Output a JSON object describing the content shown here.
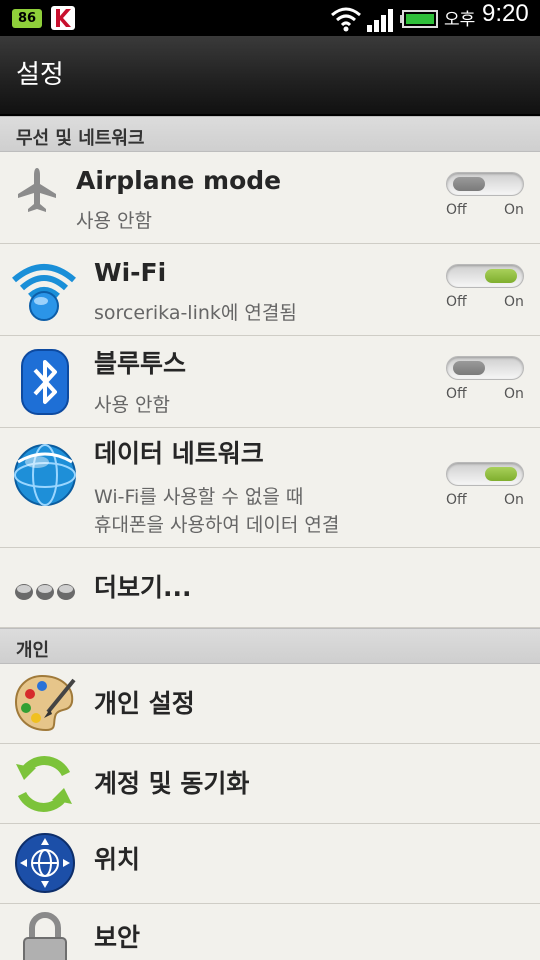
{
  "status_bar": {
    "battery_badge": "86",
    "ampm": "오후",
    "time": "9:20"
  },
  "title": "설정",
  "sections": {
    "wireless": "무선 및 네트워크",
    "personal": "개인"
  },
  "rows": {
    "airplane": {
      "label": "Airplane mode",
      "sub": "사용 안함",
      "toggle_off": "Off",
      "toggle_on": "On",
      "state": "off"
    },
    "wifi": {
      "label": "Wi-Fi",
      "sub": "sorcerika-link에 연결됨",
      "toggle_off": "Off",
      "toggle_on": "On",
      "state": "on"
    },
    "bluetooth": {
      "label": "블루투스",
      "sub": "사용 안함",
      "toggle_off": "Off",
      "toggle_on": "On",
      "state": "off"
    },
    "data": {
      "label": "데이터 네트워크",
      "sub1": "Wi-Fi를 사용할 수 없을 때",
      "sub2": "휴대폰을 사용하여 데이터 연결",
      "toggle_off": "Off",
      "toggle_on": "On",
      "state": "on"
    },
    "more": {
      "label": "더보기..."
    },
    "personalize": {
      "label": "개인 설정"
    },
    "accounts": {
      "label": "계정 및 동기화"
    },
    "location": {
      "label": "위치"
    },
    "security": {
      "label": "보안"
    }
  },
  "icons": {
    "airplane": "airplane-icon",
    "wifi": "wifi-icon",
    "bluetooth": "bluetooth-icon",
    "data": "globe-icon",
    "more": "more-dots-icon",
    "personalize": "palette-icon",
    "accounts": "sync-icon",
    "location": "location-compass-icon",
    "security": "lock-icon"
  },
  "colors": {
    "toggle_on": "#8bbd3c",
    "toggle_off": "#8a8a8a",
    "bluetooth_blue": "#1e6fd6",
    "sync_green": "#7cc33a"
  }
}
